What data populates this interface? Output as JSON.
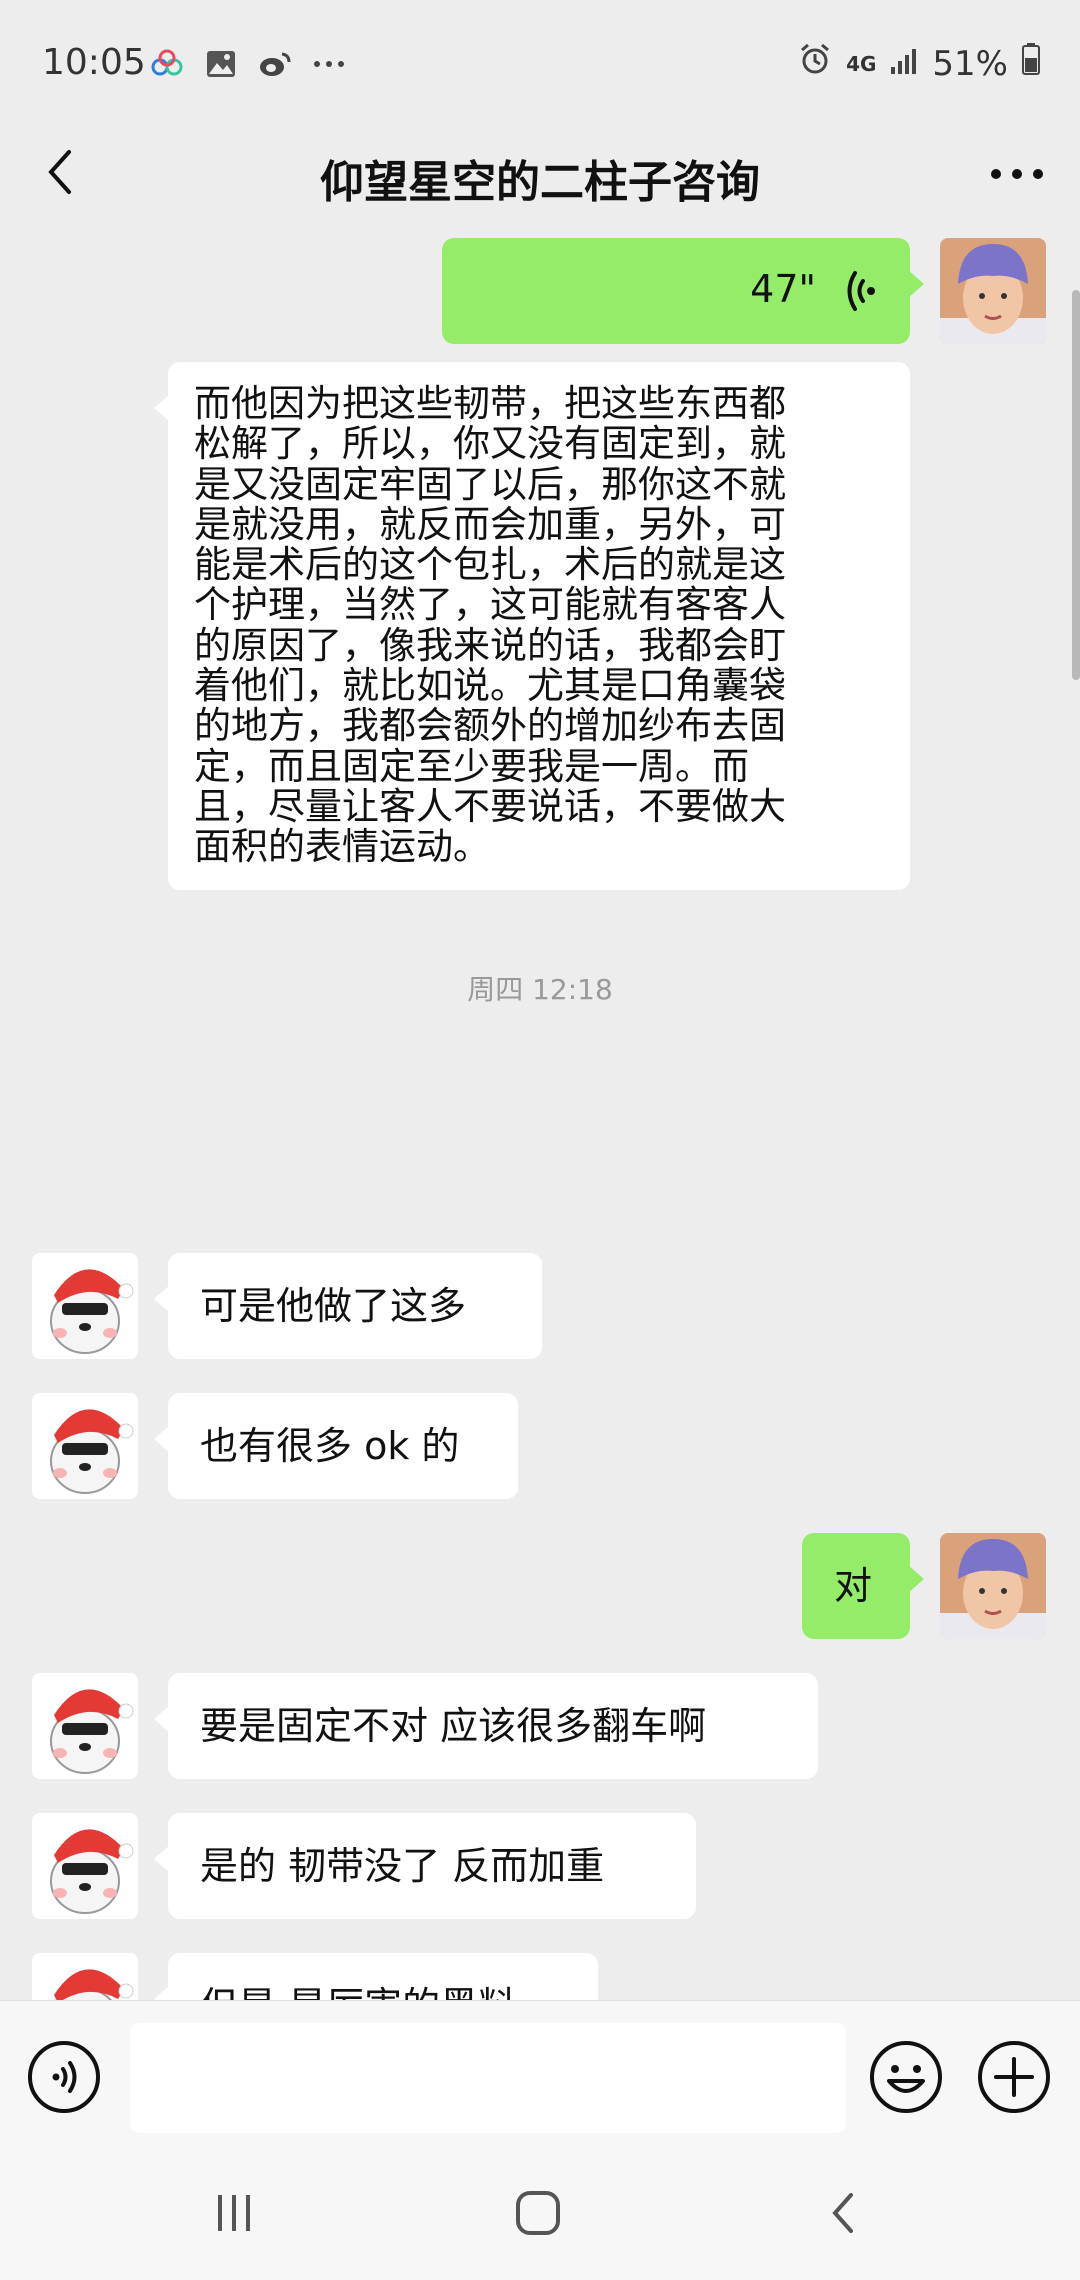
{
  "status_bar": {
    "time": "10:05",
    "battery": "51%",
    "network": "4G",
    "icons": [
      "baidu-cloud-icon",
      "gallery-icon",
      "weibo-icon",
      "more-dots-icon",
      "alarm-icon",
      "signal-icon",
      "battery-icon"
    ]
  },
  "header": {
    "title": "仰望星空的二柱子咨询"
  },
  "messages": {
    "voice_duration": "47\"",
    "long_text": [
      "而他因为把这些韧带，把这些东西都",
      "松解了，所以，你又没有固定到，就",
      "是又没固定牢固了以后，那你这不就",
      "是就没用，就反而会加重，另外，可",
      "能是术后的这个包扎，术后的就是这",
      "个护理，当然了，这可能就有客客人",
      "的原因了，像我来说的话，我都会盯",
      "着他们，就比如说。尤其是口角囊袋",
      "的地方，我都会额外的增加纱布去固",
      "定，而且固定至少要我是一周。而",
      "且，尽量让客人不要说话，不要做大",
      "面积的表情运动。"
    ],
    "timestamp": "周四 12:18",
    "m1": "可是他做了这多",
    "m2": "也有很多 ok 的",
    "m3": "对",
    "m4": "要是固定不对 应该很多翻车啊",
    "m5": "是的 韧带没了 反而加重",
    "m6": "但是 是厉害的黑料"
  },
  "input": {
    "placeholder": ""
  },
  "colors": {
    "background": "#ededed",
    "green_bubble": "#95ec69",
    "white_bubble": "#ffffff"
  }
}
